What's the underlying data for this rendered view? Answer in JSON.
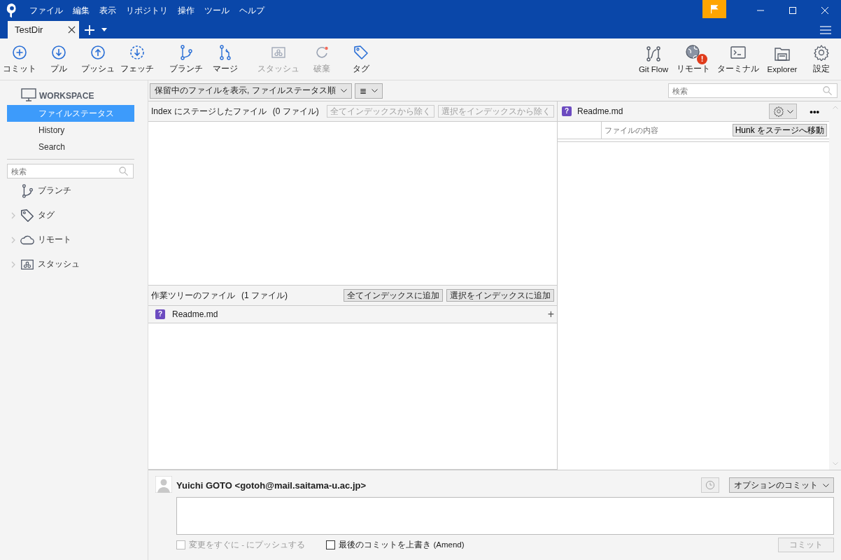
{
  "menu": [
    "ファイル",
    "編集",
    "表示",
    "リポジトリ",
    "操作",
    "ツール",
    "ヘルプ"
  ],
  "tabs": [
    {
      "label": "TestDir",
      "selected": true
    }
  ],
  "toolbar": {
    "left": [
      {
        "label": "コミット",
        "kind": "plus",
        "disabled": false
      },
      {
        "label": "プル",
        "kind": "down",
        "disabled": false
      },
      {
        "label": "プッシュ",
        "kind": "up",
        "disabled": false
      },
      {
        "label": "フェッチ",
        "kind": "fetch",
        "disabled": false
      },
      {
        "label": "ブランチ",
        "kind": "branch",
        "disabled": false
      },
      {
        "label": "マージ",
        "kind": "merge",
        "disabled": false
      },
      {
        "label": "スタッシュ",
        "kind": "stash",
        "disabled": true
      },
      {
        "label": "破棄",
        "kind": "discard",
        "disabled": true
      },
      {
        "label": "タグ",
        "kind": "tag",
        "disabled": false
      }
    ],
    "right": [
      {
        "label": "Git Flow",
        "kind": "gitflow"
      },
      {
        "label": "リモート",
        "kind": "globe",
        "badge": "!"
      },
      {
        "label": "ターミナル",
        "kind": "terminal"
      },
      {
        "label": "Explorer",
        "kind": "folder"
      },
      {
        "label": "設定",
        "kind": "gear"
      }
    ]
  },
  "sidebar": {
    "workspace": "WORKSPACE",
    "items": [
      {
        "label": "ファイルステータス",
        "selected": true
      },
      {
        "label": "History",
        "selected": false
      },
      {
        "label": "Search",
        "selected": false
      }
    ],
    "search": {
      "placeholder": "検索"
    },
    "sections": [
      {
        "label": "ブランチ",
        "kind": "branch",
        "chevron": false
      },
      {
        "label": "タグ",
        "kind": "tag",
        "chevron": true
      },
      {
        "label": "リモート",
        "kind": "cloud",
        "chevron": true
      },
      {
        "label": "スタッシュ",
        "kind": "stash",
        "chevron": true
      }
    ]
  },
  "filter": {
    "label": "保留中のファイルを表示, ファイルステータス順",
    "view_icon": "≣"
  },
  "search": {
    "placeholder": "検索"
  },
  "staged": {
    "title": "Index にステージしたファイル",
    "count": "(0 ファイル)",
    "buttons": [
      {
        "label": "全てインデックスから除く",
        "disabled": true
      },
      {
        "label": "選択をインデックスから除く",
        "disabled": true
      }
    ]
  },
  "unstaged": {
    "title": "作業ツリーのファイル",
    "count": "(1 ファイル)",
    "buttons": [
      {
        "label": "全てインデックスに追加",
        "disabled": false
      },
      {
        "label": "選択をインデックスに追加",
        "disabled": false
      }
    ],
    "files": [
      {
        "name": "Readme.md",
        "status": "?",
        "action": "+"
      }
    ]
  },
  "diff": {
    "file": "Readme.md",
    "status": "?",
    "menu": "•••",
    "column": "ファイルの内容",
    "hunk_button": "Hunk をステージへ移動"
  },
  "commit": {
    "author": "Yuichi GOTO <gotoh@mail.saitama-u.ac.jp>",
    "options": "オプションのコミット",
    "checkboxes": [
      {
        "label": "変更をすぐに - にプッシュする",
        "checked": false,
        "disabled": true
      },
      {
        "label": "最後のコミットを上書き (Amend)",
        "checked": false,
        "disabled": false
      }
    ],
    "button": {
      "label": "コミット",
      "disabled": true
    }
  }
}
